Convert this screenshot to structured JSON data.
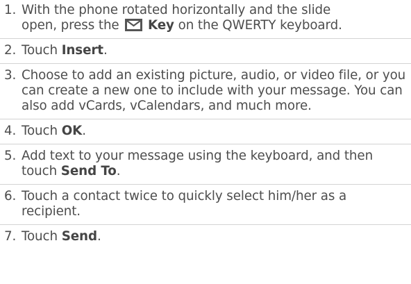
{
  "steps": [
    {
      "number": "1.",
      "line_1": "With the phone rotated horizontally and the slide",
      "line_2_pre": "open, press the",
      "key_label": "Key",
      "line_2_post": "on the QWERTY keyboard.",
      "icon": "envelope-icon"
    },
    {
      "number": "2.",
      "pre": "Touch",
      "bold": "Insert",
      "post": "."
    },
    {
      "number": "3.",
      "text": "Choose to add an existing picture, audio, or video file, or you can create a new one to include with your message. You can also add vCards, vCalendars, and much more."
    },
    {
      "number": "4.",
      "pre": "Touch",
      "bold": "OK",
      "post": "."
    },
    {
      "number": "5.",
      "pre": "Add text to your message using the keyboard, and then touch",
      "bold": "Send To",
      "post": "."
    },
    {
      "number": "6.",
      "text": "Touch a contact twice to quickly select him/her as a recipient."
    },
    {
      "number": "7.",
      "pre": "Touch",
      "bold": "Send",
      "post": "."
    }
  ]
}
